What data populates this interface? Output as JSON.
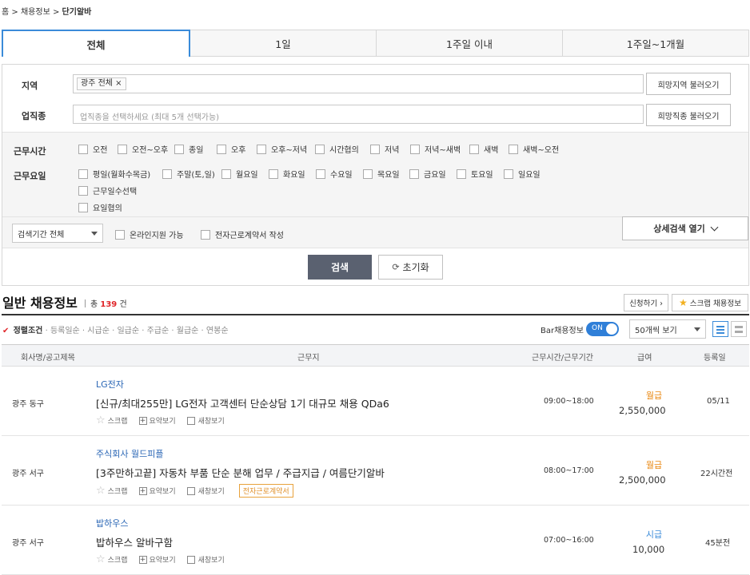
{
  "breadcrumb": {
    "home": "홈",
    "sep": ">",
    "item1": "채용정보",
    "item2": "단기알바"
  },
  "tabs": [
    "전체",
    "1일",
    "1주일 이내",
    "1주일~1개월"
  ],
  "filter": {
    "region_label": "지역",
    "region_chip": "광주 전체 ×",
    "region_button": "희망지역 불러오기",
    "job_label": "업직종",
    "job_placeholder": "업직종을 선택하세요 (최대 5개 선택가능)",
    "job_button": "희망직종 불러오기",
    "time_label": "근무시간",
    "time_options": [
      "오전",
      "오전~오후",
      "종일",
      "오후",
      "오후~저녁",
      "시간협의",
      "저녁",
      "저녁~새벽",
      "새벽",
      "새벽~오전"
    ],
    "day_label": "근무요일",
    "day_options": [
      "평일(월화수목금)",
      "주말(토,일)",
      "월요일",
      "화요일",
      "수요일",
      "목요일",
      "금요일",
      "토요일",
      "일요일"
    ],
    "day_extra": [
      "근무일수선택",
      "요일협의"
    ],
    "period_select": "검색기간 전체",
    "online": "온라인지원 가능",
    "econtract": "전자근로계약서 작성",
    "detail_button": "상세검색 열기",
    "search_button": "검색",
    "reset_button": "초기화"
  },
  "list": {
    "title": "일반 채용정보",
    "count_prefix": "총",
    "count": "139",
    "count_suffix": "건",
    "apply_button": "신청하기 ›",
    "scrap_button": "스크랩 채용정보",
    "sort": {
      "active": "정렬조건",
      "options": [
        "등록일순",
        "시급순",
        "일급순",
        "주급순",
        "월급순",
        "연봉순"
      ]
    },
    "bar_label": "Bar채용정보",
    "toggle": "ON",
    "per_page": "50개씩 보기",
    "columns": [
      "회사명/공고제목",
      "근무지",
      "근무시간/근무기간",
      "급여",
      "등록일"
    ],
    "actions": {
      "scrap": "스크랩",
      "summary": "요약보기",
      "newwin": "새창보기"
    },
    "colors": {
      "monthly": "#e8850c",
      "hourly": "#3a8bd9"
    },
    "rows": [
      {
        "location": "광주 동구",
        "company": "LG전자",
        "title": "[신규/최대255만] LG전자 고객센터 단순상담 1기 대규모 채용 QDa6",
        "time": "09:00~18:00",
        "pay_type": "월급",
        "pay": "2,550,000",
        "date": "05/11",
        "badge": ""
      },
      {
        "location": "광주 서구",
        "company": "주식회사 월드피플",
        "title": "[3주만하고끝] 자동차 부품 단순 분해 업무 / 주급지급 / 여름단기알바",
        "time": "08:00~17:00",
        "pay_type": "월급",
        "pay": "2,500,000",
        "date": "22시간전",
        "badge": "전자근로계약서"
      },
      {
        "location": "광주 서구",
        "company": "밥하우스",
        "title": "밥하우스 알바구함",
        "time": "07:00~16:00",
        "pay_type": "시급",
        "pay": "10,000",
        "date": "45분전",
        "badge": ""
      }
    ]
  }
}
